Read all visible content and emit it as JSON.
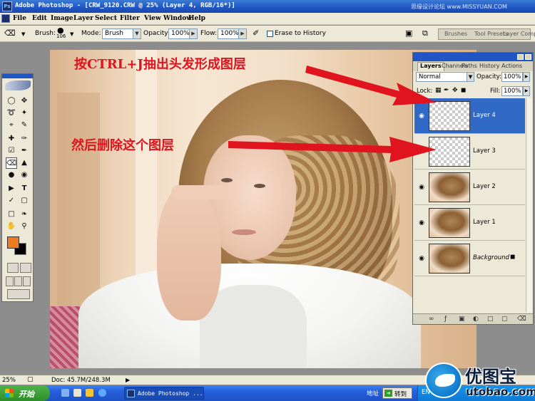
{
  "app": {
    "title": "Adobe Photoshop - [CRW_9120.CRW @ 25% (Layer 4, RGB/16*)]",
    "watermark_top": "思缘设计论坛 www.MISSYUAN.COM"
  },
  "menu": [
    "File",
    "Edit",
    "Image",
    "Layer",
    "Select",
    "Filter",
    "View",
    "Window",
    "Help"
  ],
  "options": {
    "brush_label": "Brush:",
    "brush_size": "106",
    "mode_label": "Mode:",
    "mode_value": "Brush",
    "opacity_label": "Opacity:",
    "opacity_value": "100%",
    "flow_label": "Flow:",
    "flow_value": "100%",
    "erase_history_label": "Erase to History",
    "palette_well": [
      "Brushes",
      "Tool Presets",
      "Layer Comps"
    ]
  },
  "annotations": {
    "top": "按CTRL+J抽出头发形成图层",
    "middle": "然后删除这个图层"
  },
  "layers_panel": {
    "tabs": [
      "Layers",
      "Channels",
      "Paths",
      "History",
      "Actions"
    ],
    "blend_mode": "Normal",
    "opacity_label": "Opacity:",
    "opacity_value": "100%",
    "lock_label": "Lock:",
    "fill_label": "Fill:",
    "fill_value": "100%",
    "layers": [
      {
        "name": "Layer 4",
        "selected": true,
        "visible": true
      },
      {
        "name": "Layer 3",
        "selected": false,
        "visible": false
      },
      {
        "name": "Layer 2",
        "selected": false,
        "visible": true
      },
      {
        "name": "Layer 1",
        "selected": false,
        "visible": true
      },
      {
        "name": "Background",
        "selected": false,
        "visible": true
      }
    ]
  },
  "status": {
    "zoom": "25%",
    "doc": "Doc: 45.7M/248.3M"
  },
  "taskbar": {
    "start_label": "开始",
    "task_label": "Adobe Photoshop ...",
    "address_label": "地址",
    "go_label": "转到",
    "lang": "EN"
  },
  "brand": {
    "name": "优图宝",
    "url": "utobao.com"
  },
  "colors": {
    "foreground": "#f07a22",
    "background": "#000000",
    "annotation": "#e0141e",
    "selection": "#3169c6"
  }
}
